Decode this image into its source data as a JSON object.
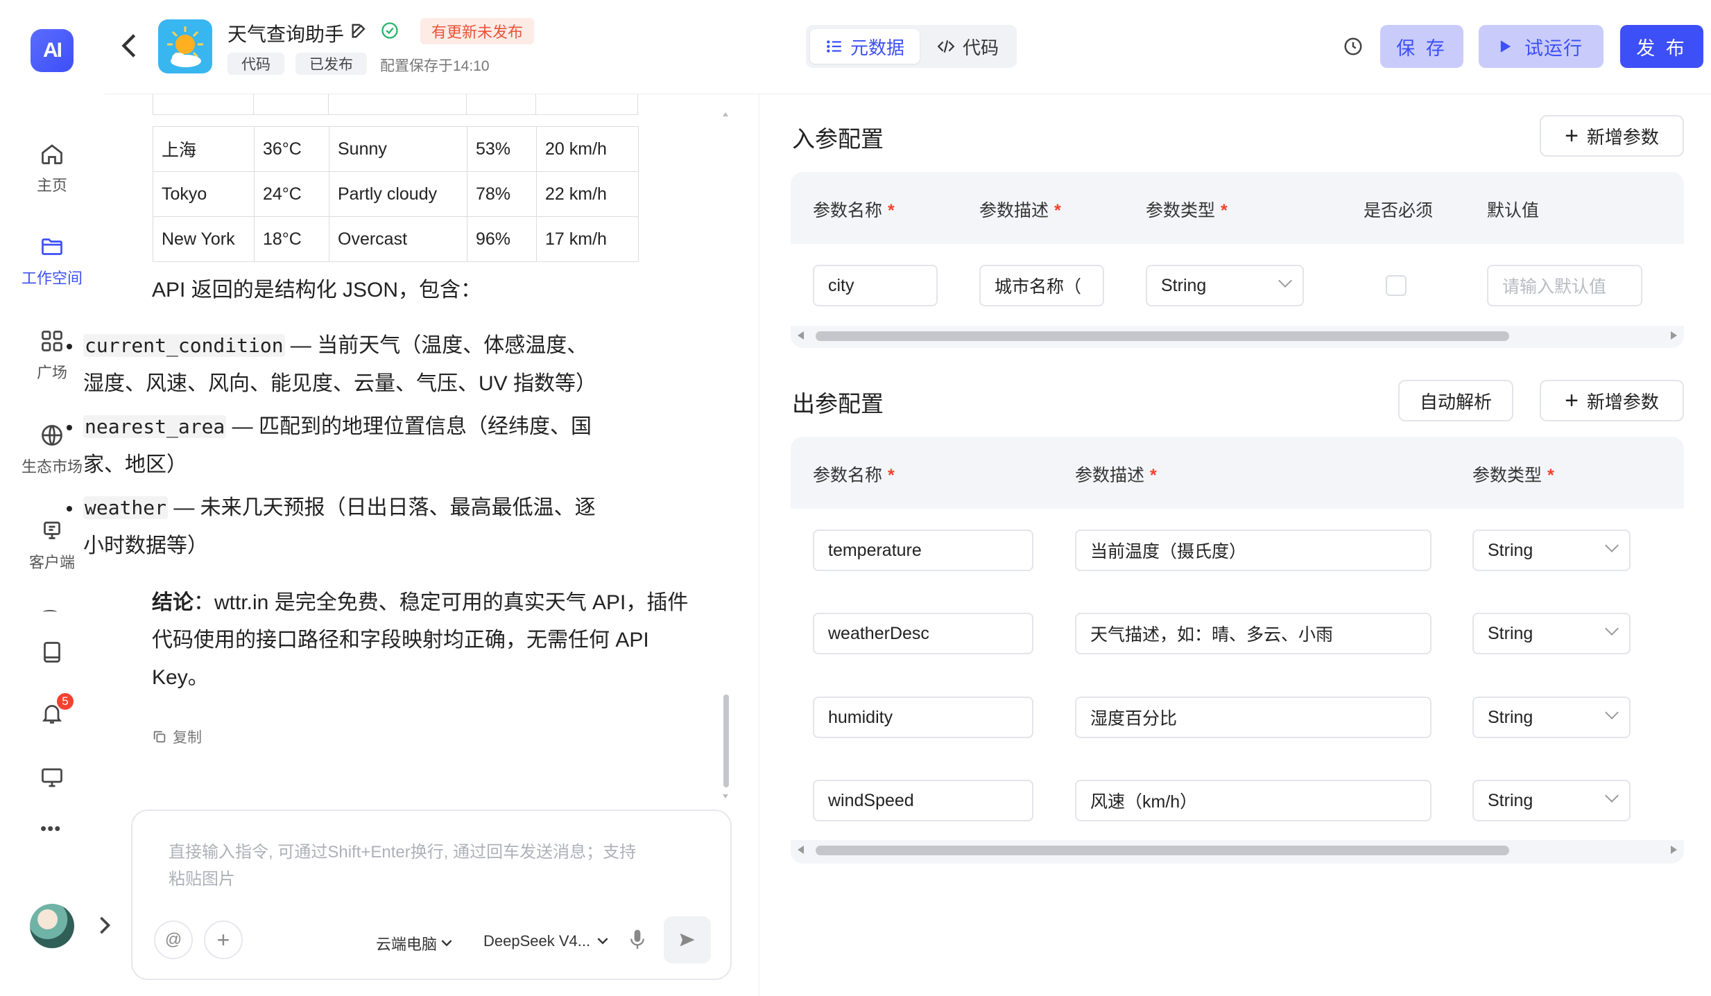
{
  "nav": {
    "logo": "AI",
    "items": [
      {
        "label": "主页",
        "icon": "home-icon"
      },
      {
        "label": "工作空间",
        "icon": "folder-icon"
      },
      {
        "label": "广场",
        "icon": "grid-icon"
      },
      {
        "label": "生态市场",
        "icon": "globe-icon"
      },
      {
        "label": "客户端",
        "icon": "client-icon"
      }
    ],
    "notification_count": "5",
    "more": "•••"
  },
  "header": {
    "plugin_name": "天气查询助手",
    "update_badge": "有更新未发布",
    "tags": [
      "代码",
      "已发布"
    ],
    "saved_status": "配置保存于14:10",
    "tab_metadata": "元数据",
    "tab_code": "代码",
    "save_label": "保 存",
    "test_run_label": "试运行",
    "publish_label": "发 布",
    "colors": {
      "accent": "#3d4ff7",
      "save_bg": "#c9ccfb",
      "testrun_bg": "#c9ccfb",
      "badge_bg": "#fdece6",
      "badge_text": "#e8553a"
    }
  },
  "chat": {
    "weather_table": [
      [
        "上海",
        "36°C",
        "Sunny",
        "53%",
        "20 km/h"
      ],
      [
        "Tokyo",
        "24°C",
        "Partly cloudy",
        "78%",
        "22 km/h"
      ],
      [
        "New York",
        "18°C",
        "Overcast",
        "96%",
        "17 km/h"
      ]
    ],
    "api_intro": "API 返回的是结构化 JSON，包含：",
    "bullets": [
      {
        "code": "current_condition",
        "text_line1": " — 当前天气（温度、体感温度、",
        "text_line2": "湿度、风速、风向、能见度、云量、气压、UV 指数等）"
      },
      {
        "code": "nearest_area",
        "text_line1": " — 匹配到的地理位置信息（经纬度、国",
        "text_line2": "家、地区）"
      },
      {
        "code": "weather",
        "text_line1": " — 未来几天预报（日出日落、最高最低温、逐",
        "text_line2": "小时数据等）"
      }
    ],
    "conclusion_bold": "结论",
    "conclusion_line1": "：wttr.in 是完全免费、稳定可用的真实天气 API，插件",
    "conclusion_line2": "代码使用的接口路径和字段映射均正确，无需任何 API",
    "conclusion_line3": "Key。",
    "copy_label": "复制",
    "input_placeholder_line1": "直接输入指令, 可通过Shift+Enter换行, 通过回车发送消息；支持",
    "input_placeholder_line2": "粘贴图片",
    "at_symbol": "@",
    "plus_symbol": "+",
    "cloud_pc_label": "云端电脑",
    "model_label": "DeepSeek V4..."
  },
  "input_params": {
    "title": "入参配置",
    "add_label": "新增参数",
    "headers": [
      "参数名称",
      "参数描述",
      "参数类型",
      "是否必须",
      "默认值"
    ],
    "rows": [
      {
        "name": "city",
        "desc": "城市名称（",
        "type": "String",
        "required": false,
        "default_placeholder": "请输入默认值"
      }
    ]
  },
  "output_params": {
    "title": "出参配置",
    "auto_parse_label": "自动解析",
    "add_label": "新增参数",
    "headers": [
      "参数名称",
      "参数描述",
      "参数类型"
    ],
    "rows": [
      {
        "name": "temperature",
        "desc": "当前温度（摄氏度）",
        "type": "String"
      },
      {
        "name": "weatherDesc",
        "desc": "天气描述，如：晴、多云、小雨",
        "type": "String"
      },
      {
        "name": "humidity",
        "desc": "湿度百分比",
        "type": "String"
      },
      {
        "name": "windSpeed",
        "desc": "风速（km/h）",
        "type": "String"
      }
    ]
  }
}
